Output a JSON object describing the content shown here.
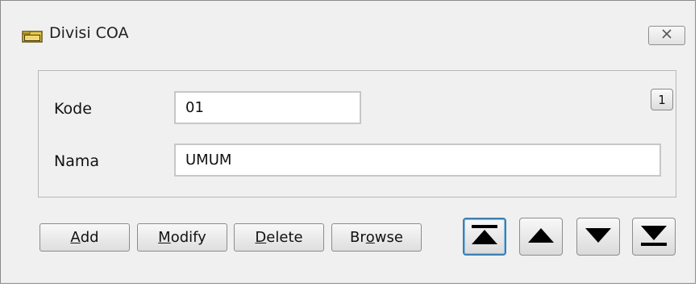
{
  "window": {
    "title": "Divisi COA",
    "close_label": "⌧"
  },
  "record": {
    "number": "1"
  },
  "form": {
    "kode_label": "Kode",
    "kode_value": "01",
    "nama_label": "Nama",
    "nama_value": "UMUM"
  },
  "buttons": {
    "add": {
      "hotkey": "A",
      "rest": "dd"
    },
    "modify": {
      "hotkey": "M",
      "rest": "odify"
    },
    "delete": {
      "hotkey": "D",
      "rest": "elete"
    },
    "browse": {
      "before": "Br",
      "hotkey": "o",
      "rest": "wse"
    }
  },
  "navigation": {
    "icons": [
      "first-record-icon",
      "previous-record-icon",
      "next-record-icon",
      "last-record-icon"
    ]
  }
}
